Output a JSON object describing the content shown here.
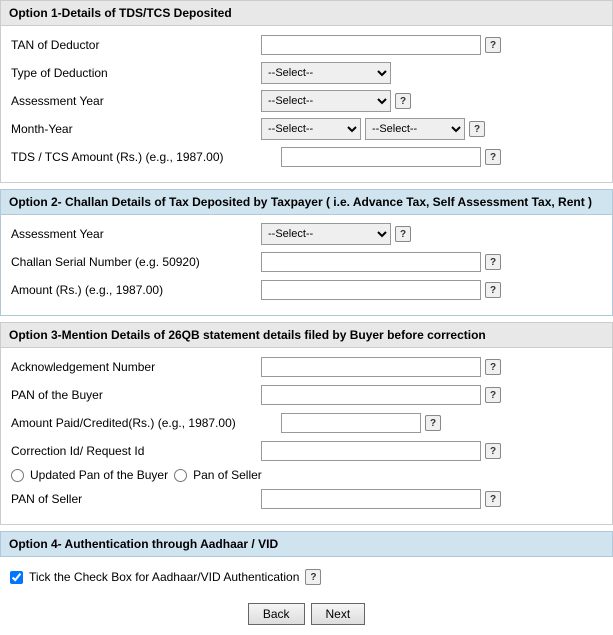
{
  "option1": {
    "header": "Option 1-Details of TDS/TCS Deposited",
    "fields": {
      "tan_label": "TAN of Deductor",
      "type_deduction_label": "Type of Deduction",
      "assessment_year_label": "Assessment Year",
      "month_year_label": "Month-Year",
      "tds_amount_label": "TDS / TCS Amount (Rs.) (e.g., 1987.00)"
    },
    "select_default": "--Select--",
    "select_options": [
      "--Select--"
    ]
  },
  "option2": {
    "header": "Option 2- Challan Details of Tax Deposited by Taxpayer ( i.e. Advance Tax, Self Assessment Tax, Rent )",
    "fields": {
      "assessment_year_label": "Assessment Year",
      "challan_serial_label": "Challan Serial Number (e.g. 50920)",
      "amount_label": "Amount (Rs.) (e.g., 1987.00)"
    },
    "select_default": "--Select--"
  },
  "option3": {
    "header": "Option 3-Mention Details of 26QB statement details filed by Buyer before correction",
    "fields": {
      "ack_number_label": "Acknowledgement Number",
      "pan_buyer_label": "PAN of the Buyer",
      "amount_paid_label": "Amount Paid/Credited(Rs.) (e.g., 1987.00)",
      "correction_id_label": "Correction Id/ Request Id",
      "radio_updated_pan": "Updated Pan of the Buyer",
      "radio_pan_seller": "Pan of Seller",
      "pan_seller_label": "PAN of Seller"
    }
  },
  "option4": {
    "header": "Option 4- Authentication through Aadhaar / VID",
    "checkbox_label": "Tick the Check Box for Aadhaar/VID Authentication"
  },
  "buttons": {
    "back": "Back",
    "next": "Next"
  },
  "help_icon": "?"
}
